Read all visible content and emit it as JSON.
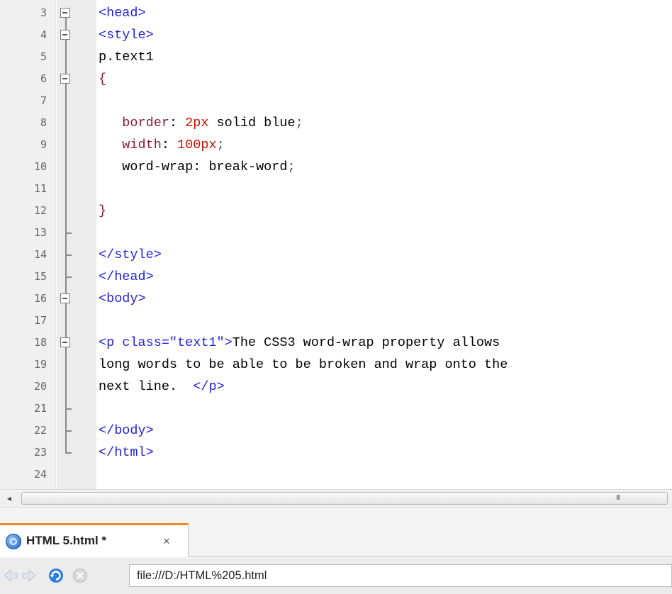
{
  "editor": {
    "lines": [
      {
        "n": "3",
        "fold": "box",
        "tokens": [
          {
            "t": "<head>",
            "c": "tag"
          }
        ]
      },
      {
        "n": "4",
        "fold": "box",
        "tokens": [
          {
            "t": "<style>",
            "c": "tag"
          }
        ]
      },
      {
        "n": "5",
        "fold": "line",
        "tokens": [
          {
            "t": "p.text1",
            "c": "plain"
          }
        ]
      },
      {
        "n": "6",
        "fold": "box",
        "tokens": [
          {
            "t": "{",
            "c": "brace"
          }
        ]
      },
      {
        "n": "7",
        "fold": "line",
        "tokens": []
      },
      {
        "n": "8",
        "fold": "line",
        "tokens": [
          {
            "t": "   border",
            "c": "prop"
          },
          {
            "t": ": ",
            "c": "plain"
          },
          {
            "t": "2px",
            "c": "val"
          },
          {
            "t": " solid blue",
            "c": "plain"
          },
          {
            "t": ";",
            "c": "pun"
          }
        ]
      },
      {
        "n": "9",
        "fold": "line",
        "tokens": [
          {
            "t": "   width",
            "c": "prop"
          },
          {
            "t": ": ",
            "c": "plain"
          },
          {
            "t": "100px",
            "c": "val"
          },
          {
            "t": ";",
            "c": "pun"
          }
        ]
      },
      {
        "n": "10",
        "fold": "line",
        "tokens": [
          {
            "t": "   word-wrap",
            "c": "plain"
          },
          {
            "t": ": ",
            "c": "plain"
          },
          {
            "t": "break-word",
            "c": "plain"
          },
          {
            "t": ";",
            "c": "pun"
          }
        ]
      },
      {
        "n": "11",
        "fold": "line",
        "tokens": []
      },
      {
        "n": "12",
        "fold": "line",
        "tokens": [
          {
            "t": "}",
            "c": "brace"
          }
        ]
      },
      {
        "n": "13",
        "fold": "branch",
        "tokens": []
      },
      {
        "n": "14",
        "fold": "branch",
        "tokens": [
          {
            "t": "</style>",
            "c": "tag"
          }
        ]
      },
      {
        "n": "15",
        "fold": "branch",
        "tokens": [
          {
            "t": "</head>",
            "c": "tag"
          }
        ]
      },
      {
        "n": "16",
        "fold": "box",
        "tokens": [
          {
            "t": "<body>",
            "c": "tag"
          }
        ]
      },
      {
        "n": "17",
        "fold": "line",
        "tokens": []
      },
      {
        "n": "18",
        "fold": "box",
        "tokens": [
          {
            "t": "<p class=\"text1\">",
            "c": "tag"
          },
          {
            "t": "The CSS3 word-wrap property allows",
            "c": "plain"
          }
        ]
      },
      {
        "n": "19",
        "fold": "line",
        "tokens": [
          {
            "t": "long words to be able to be broken and wrap onto the",
            "c": "plain"
          }
        ]
      },
      {
        "n": "20",
        "fold": "line",
        "tokens": [
          {
            "t": "next line.  ",
            "c": "plain"
          },
          {
            "t": "</p>",
            "c": "tag"
          }
        ]
      },
      {
        "n": "21",
        "fold": "branch",
        "tokens": []
      },
      {
        "n": "22",
        "fold": "branch",
        "tokens": [
          {
            "t": "</body>",
            "c": "tag"
          }
        ]
      },
      {
        "n": "23",
        "fold": "end",
        "tokens": [
          {
            "t": "</html>",
            "c": "tag"
          }
        ]
      },
      {
        "n": "24",
        "fold": "none",
        "tokens": []
      }
    ]
  },
  "scrollbar": {
    "left_arrow": "◂",
    "grip": "III"
  },
  "tab": {
    "label": "HTML 5.html *",
    "close": "×",
    "icon": "browser-globe-icon"
  },
  "nav": {
    "url": "file:///D:/HTML%205.html"
  },
  "colors": {
    "tag": "#2222dd",
    "prop": "#8b1a3a",
    "val": "#cc1100",
    "tab_accent": "#f08a24"
  }
}
